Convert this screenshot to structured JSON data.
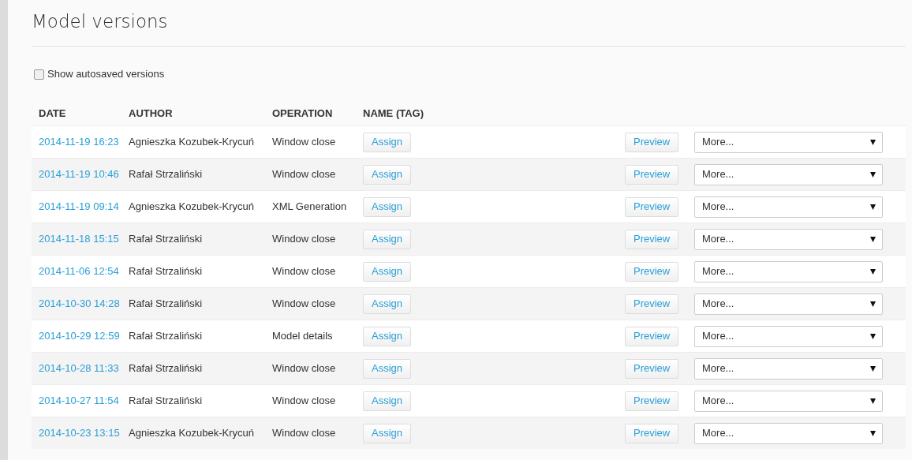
{
  "page": {
    "title": "Model versions"
  },
  "autosave": {
    "label": "Show autosaved versions",
    "checked": false
  },
  "table": {
    "columns": [
      "DATE",
      "AUTHOR",
      "OPERATION",
      "NAME (TAG)"
    ],
    "rows": [
      {
        "date": "2014-11-19 16:23",
        "author": "Agnieszka Kozubek-Krycuń",
        "operation": "Window close",
        "assign": "Assign",
        "preview": "Preview",
        "more": "More..."
      },
      {
        "date": "2014-11-19 10:46",
        "author": "Rafał Strzaliński",
        "operation": "Window close",
        "assign": "Assign",
        "preview": "Preview",
        "more": "More..."
      },
      {
        "date": "2014-11-19 09:14",
        "author": "Agnieszka Kozubek-Krycuń",
        "operation": "XML Generation",
        "assign": "Assign",
        "preview": "Preview",
        "more": "More..."
      },
      {
        "date": "2014-11-18 15:15",
        "author": "Rafał Strzaliński",
        "operation": "Window close",
        "assign": "Assign",
        "preview": "Preview",
        "more": "More..."
      },
      {
        "date": "2014-11-06 12:54",
        "author": "Rafał Strzaliński",
        "operation": "Window close",
        "assign": "Assign",
        "preview": "Preview",
        "more": "More..."
      },
      {
        "date": "2014-10-30 14:28",
        "author": "Rafał Strzaliński",
        "operation": "Window close",
        "assign": "Assign",
        "preview": "Preview",
        "more": "More..."
      },
      {
        "date": "2014-10-29 12:59",
        "author": "Rafał Strzaliński",
        "operation": "Model details",
        "assign": "Assign",
        "preview": "Preview",
        "more": "More..."
      },
      {
        "date": "2014-10-28 11:33",
        "author": "Rafał Strzaliński",
        "operation": "Window close",
        "assign": "Assign",
        "preview": "Preview",
        "more": "More..."
      },
      {
        "date": "2014-10-27 11:54",
        "author": "Rafał Strzaliński",
        "operation": "Window close",
        "assign": "Assign",
        "preview": "Preview",
        "more": "More..."
      },
      {
        "date": "2014-10-23 13:15",
        "author": "Agnieszka Kozubek-Krycuń",
        "operation": "Window close",
        "assign": "Assign",
        "preview": "Preview",
        "more": "More..."
      }
    ]
  }
}
